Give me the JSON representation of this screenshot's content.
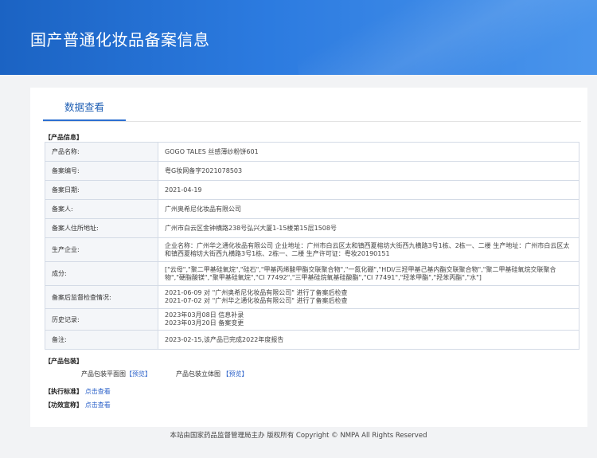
{
  "header": {
    "title": "国产普通化妆品备案信息"
  },
  "tabs": [
    {
      "label": "数据查看"
    }
  ],
  "product_info": {
    "section_label": "【产品信息】",
    "rows": [
      {
        "key": "产品名称:",
        "value": "GOGO TALES 丝感薄纱粉饼601"
      },
      {
        "key": "备案编号:",
        "value": "粤G妆网备字2021078503"
      },
      {
        "key": "备案日期:",
        "value": "2021-04-19"
      },
      {
        "key": "备案人:",
        "value": "广州奥希尼化妆品有限公司"
      },
      {
        "key": "备案人住所地址:",
        "value": "广州市白云区金钟横路238号弘兴大厦1-15楼第15层1508号"
      },
      {
        "key": "生产企业:",
        "value": "企业名称：广州华之通化妆品有限公司 企业地址：广州市白云区太和镇西夏榕坊大街西九横路3号1栋、2栋一、二楼 生产地址：广州市白云区太和镇西夏榕坊大街西九横路3号1栋、2栋一、二楼 生产许可证：粤妆20190151"
      },
      {
        "key": "成分:",
        "value": "[\"云母\",\"聚二甲基硅氧烷\",\"硅石\",\"甲基丙烯酸甲酯交联聚合物\",\"一氮化硼\",\"HDI/三羟甲基己基内酯交联聚合物\",\"聚二甲基硅氧烷交联聚合物\",\"硬脂酸镁\",\"聚甲基硅氧烷\",\"CI 77492\",\"三甲基硅烷氧基硅酸酯\",\"CI 77491\",\"羟苯甲酯\",\"羟苯丙酯\",\"水\"]"
      },
      {
        "key": "备案后监督检查情况:",
        "value": "2021-06-09 对 \"广州奥希尼化妆品有限公司\" 进行了备案后检查\n2021-07-02 对 \"广州华之通化妆品有限公司\" 进行了备案后检查"
      },
      {
        "key": "历史记录:",
        "value": "2023年03月08日 信息补录\n2023年03月20日 备案变更"
      },
      {
        "key": "备注:",
        "value": "2023-02-15,该产品已完成2022年度报告"
      }
    ]
  },
  "packaging": {
    "section_label": "【产品包装】",
    "flat_label": "产品包装平面图",
    "flat_link": "【预览】",
    "solid_label": "产品包装立体图",
    "solid_link": "【预览】"
  },
  "standard": {
    "label": "【执行标准】",
    "link": "点击查看"
  },
  "efficacy": {
    "label": "【功效宣称】",
    "link": "点击查看"
  },
  "footer": {
    "text": "本站由国家药品监督管理局主办 版权所有 Copyright © NMPA All Rights Reserved"
  },
  "colors": {
    "banner": "#2c7be0",
    "tab_accent": "#2c6fd1",
    "link": "#2c62c9"
  }
}
